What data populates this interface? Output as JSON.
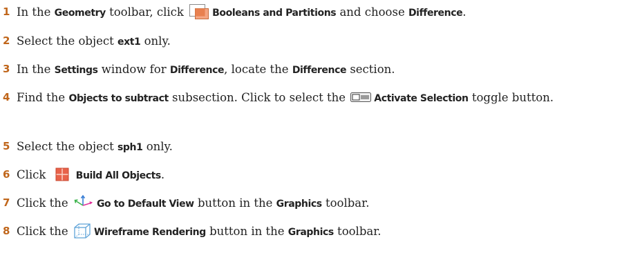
{
  "steps": [
    {
      "num": "1",
      "t1": "In the ",
      "b1": "Geometry",
      "t2": " toolbar, click ",
      "b2": "Booleans and Partitions",
      "t3": " and choose ",
      "b3": "Difference",
      "t4": ".",
      "icon": "booleans-partitions-icon"
    },
    {
      "num": "2",
      "t1": "Select the object ",
      "b1": "ext1",
      "t2": " only."
    },
    {
      "num": "3",
      "t1": "In the ",
      "b1": "Settings",
      "t2": " window for ",
      "b2": "Difference",
      "t3": ", locate the ",
      "b3": "Difference",
      "t4": " section."
    },
    {
      "num": "4",
      "t1": "Find the ",
      "b1": "Objects to subtract",
      "t2": " subsection. Click to select the ",
      "b2": "Activate Selection",
      "t3": " toggle button.",
      "icon": "activate-selection-toggle-icon"
    },
    {
      "num": "5",
      "t1": "Select the object ",
      "b1": "sph1",
      "t2": " only."
    },
    {
      "num": "6",
      "t1": "Click ",
      "b1": "Build All Objects",
      "t2": ".",
      "icon": "build-all-objects-icon"
    },
    {
      "num": "7",
      "t1": "Click the ",
      "b1": "Go to Default View",
      "t2": " button in the ",
      "b2": "Graphics",
      "t3": " toolbar.",
      "icon": "default-view-axes-icon"
    },
    {
      "num": "8",
      "t1": "Click the ",
      "b1": "Wireframe Rendering",
      "t2": " button in the ",
      "b2": "Graphics",
      "t3": " toolbar.",
      "icon": "wireframe-rendering-icon"
    }
  ],
  "colors": {
    "step_number": "#c0661b",
    "text": "#222222",
    "booleans_icon_fill": "#f4a582",
    "build_icon_fill": "#e8624a",
    "axis_x": "#e0309a",
    "axis_y": "#3bb34a",
    "axis_z": "#3a7fd5",
    "wireframe": "#5fa3d8"
  }
}
